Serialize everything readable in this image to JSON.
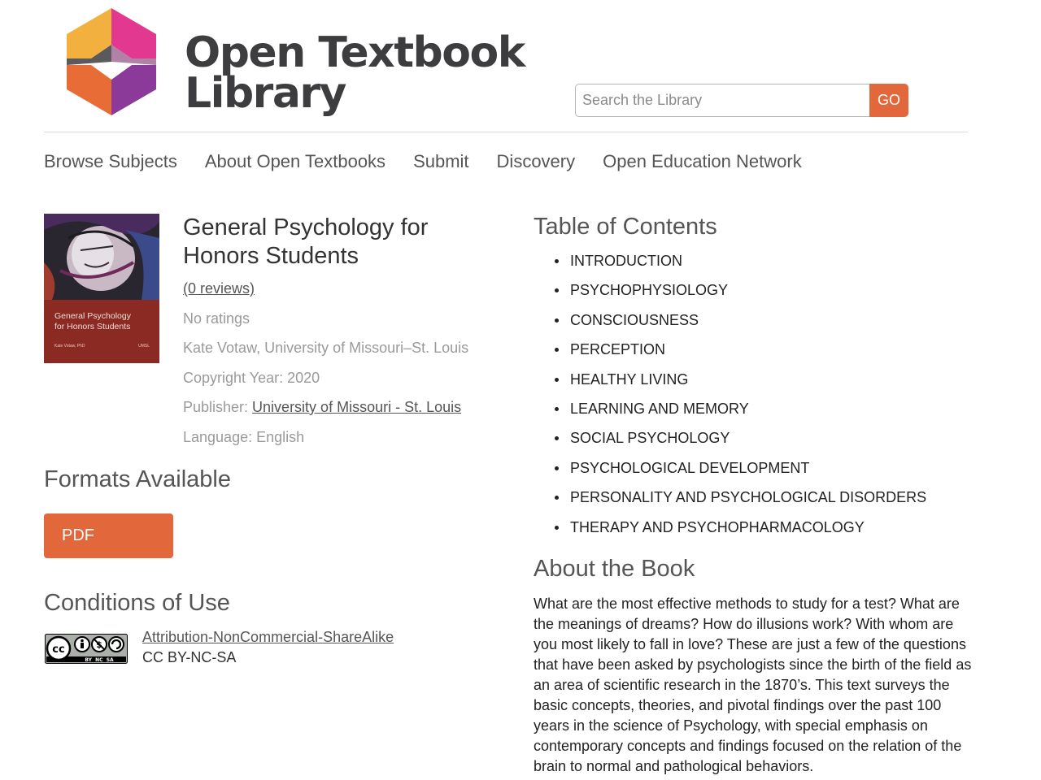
{
  "header": {
    "logo_line1": "Open Textbook",
    "logo_line2": "Library",
    "search_placeholder": "Search the Library",
    "search_button": "GO"
  },
  "nav": [
    "Browse Subjects",
    "About Open Textbooks",
    "Submit",
    "Discovery",
    "Open Education Network"
  ],
  "book": {
    "title": "General Psychology for Honors Students",
    "reviews": "(0 reviews)",
    "ratings": "No ratings",
    "author": "Kate Votaw, University of Missouri–St. Louis",
    "copyright_label": "Copyright Year: 2020",
    "publisher_label": "Publisher: ",
    "publisher_name": "University of Missouri - St. Louis",
    "language_label": "Language: English"
  },
  "cover": {
    "title_line1": "General Psychology",
    "title_line2": "for Honors Students",
    "author": "Kate Votaw, PhD",
    "publisher": "UMSL"
  },
  "formats": {
    "heading": "Formats Available",
    "pdf_label": "PDF"
  },
  "conditions": {
    "heading": "Conditions of Use",
    "license_name": "Attribution-NonCommercial-ShareAlike",
    "license_code": "CC BY-NC-SA",
    "badge_text": "BY  NC  SA"
  },
  "toc": {
    "heading": "Table of Contents",
    "items": [
      "INTRODUCTION",
      "PSYCHOPHYSIOLOGY",
      "CONSCIOUSNESS",
      "PERCEPTION",
      "HEALTHY LIVING",
      "LEARNING AND MEMORY",
      "SOCIAL PSYCHOLOGY",
      "PSYCHOLOGICAL DEVELOPMENT",
      "PERSONALITY AND PSYCHOLOGICAL DISORDERS",
      "THERAPY AND PSYCHOPHARMACOLOGY"
    ]
  },
  "about": {
    "heading": "About the Book",
    "text": "What are the most effective methods to study for a test? What are the meanings of dreams? How do illusions work? With whom are you most likely to fall in love? These are just a few of the questions that have been asked by psychologists since the birth of the field as an area of scientific research in the 1870’s. This text surveys the basic concepts, theories, and pivotal findings over the past 100 years in the science of Psychology, with special emphasis on contemporary concepts and findings focused on the relation of the brain to normal and pathological behaviors."
  },
  "colors": {
    "accent": "#e2673a",
    "text_dark": "#333333",
    "text_muted": "#9a9a9a"
  }
}
